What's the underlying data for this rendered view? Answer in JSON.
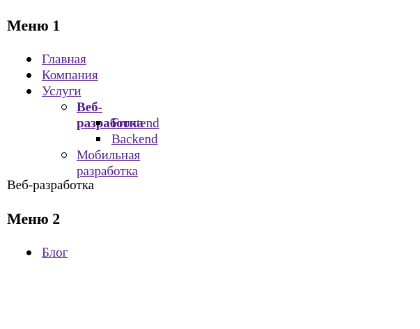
{
  "menu1": {
    "title": "Меню 1",
    "items": [
      {
        "label": "Главная"
      },
      {
        "label": "Компания"
      },
      {
        "label": "Услуги",
        "children": [
          {
            "label": "Веб-разработка",
            "children": [
              {
                "label": "Frontend"
              },
              {
                "label": "Backend"
              }
            ]
          },
          {
            "label": "Мобильная разработка"
          }
        ]
      }
    ]
  },
  "current_section": "Веб-разработка",
  "menu2": {
    "title": "Меню 2",
    "items": [
      {
        "label": "Блог"
      }
    ]
  },
  "colors": {
    "link": "#551a8b",
    "text": "#000000",
    "background": "#ffffff"
  }
}
